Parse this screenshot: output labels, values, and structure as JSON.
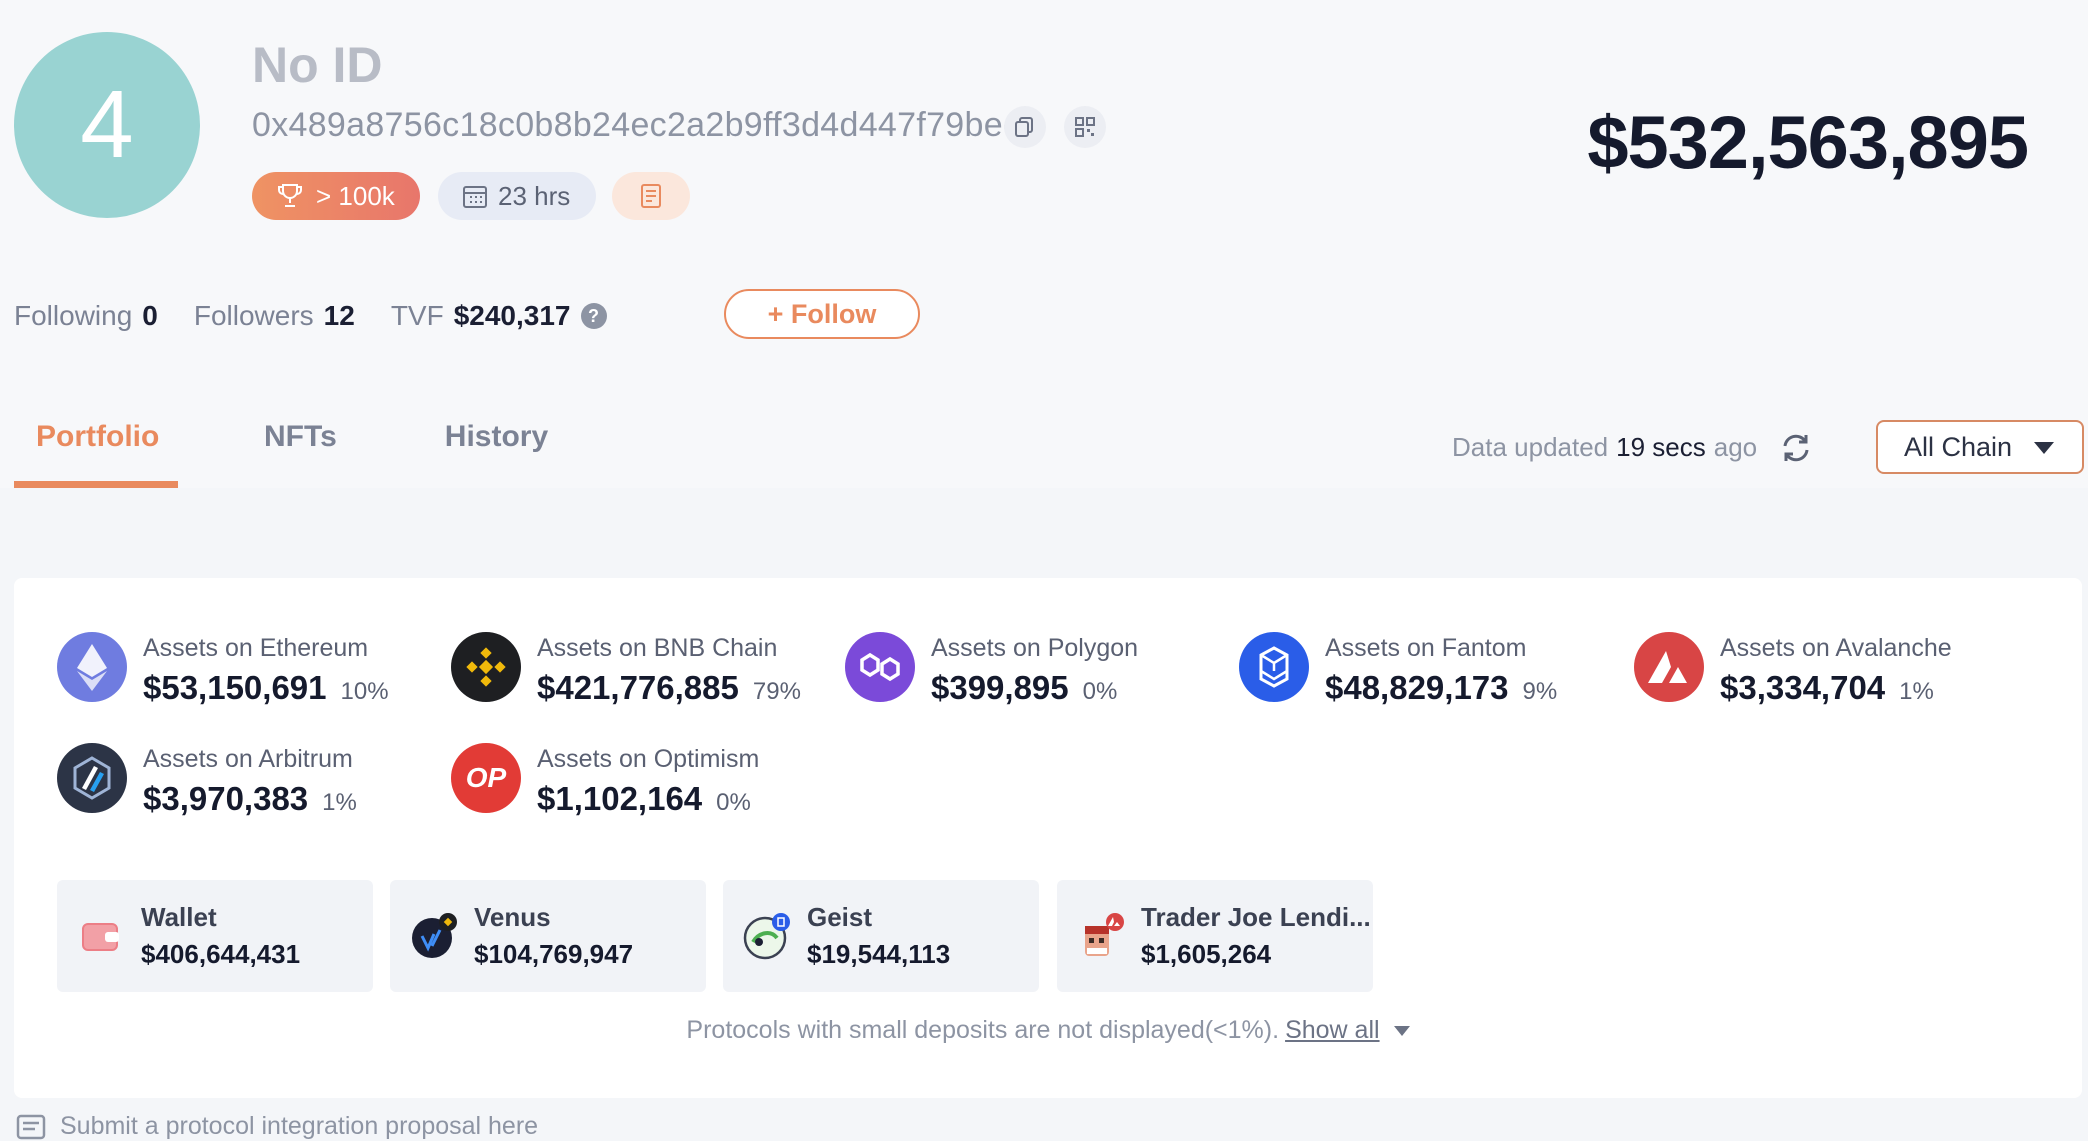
{
  "profile": {
    "avatar_text": "4",
    "name": "No ID",
    "address": "0x489a8756c18c0b8b24ec2a2b9ff3d4d447f79bec",
    "rank_badge": "> 100k",
    "time_badge": "23 hrs",
    "total_value": "$532,563,895"
  },
  "stats": {
    "following_label": "Following",
    "following_value": "0",
    "followers_label": "Followers",
    "followers_value": "12",
    "tvf_label": "TVF",
    "tvf_value": "$240,317",
    "follow_button": "+ Follow"
  },
  "tabs": [
    {
      "label": "Portfolio",
      "active": true
    },
    {
      "label": "NFTs",
      "active": false
    },
    {
      "label": "History",
      "active": false
    }
  ],
  "data_updated": {
    "prefix": "Data updated",
    "value": "19 secs",
    "suffix": "ago"
  },
  "chain_select": {
    "selected": "All Chain"
  },
  "chains": [
    {
      "label": "Assets on Ethereum",
      "amount": "$53,150,691",
      "pct": "10%",
      "color": "#6f7ce0",
      "icon": "ethereum-icon"
    },
    {
      "label": "Assets on BNB Chain",
      "amount": "$421,776,885",
      "pct": "79%",
      "color": "#1e1f22",
      "icon": "bnb-icon"
    },
    {
      "label": "Assets on Polygon",
      "amount": "$399,895",
      "pct": "0%",
      "color": "#7b4ad9",
      "icon": "polygon-icon"
    },
    {
      "label": "Assets on Fantom",
      "amount": "$48,829,173",
      "pct": "9%",
      "color": "#2a5de8",
      "icon": "fantom-icon"
    },
    {
      "label": "Assets on Avalanche",
      "amount": "$3,334,704",
      "pct": "1%",
      "color": "#d84545",
      "icon": "avalanche-icon"
    },
    {
      "label": "Assets on Arbitrum",
      "amount": "$3,970,383",
      "pct": "1%",
      "color": "#2c3446",
      "icon": "arbitrum-icon"
    },
    {
      "label": "Assets on Optimism",
      "amount": "$1,102,164",
      "pct": "0%",
      "color": "#e23b36",
      "icon": "optimism-icon"
    }
  ],
  "protocols": [
    {
      "name": "Wallet",
      "value": "$406,644,431",
      "icon": "wallet-icon"
    },
    {
      "name": "Venus",
      "value": "$104,769,947",
      "icon": "venus-icon"
    },
    {
      "name": "Geist",
      "value": "$19,544,113",
      "icon": "geist-icon"
    },
    {
      "name": "Trader Joe Lendi...",
      "value": "$1,605,264",
      "icon": "trader-joe-icon"
    }
  ],
  "note": {
    "text": "Protocols with small deposits are not displayed(<1%).",
    "show_all": "Show all"
  },
  "submit_text": "Submit a protocol integration proposal here"
}
